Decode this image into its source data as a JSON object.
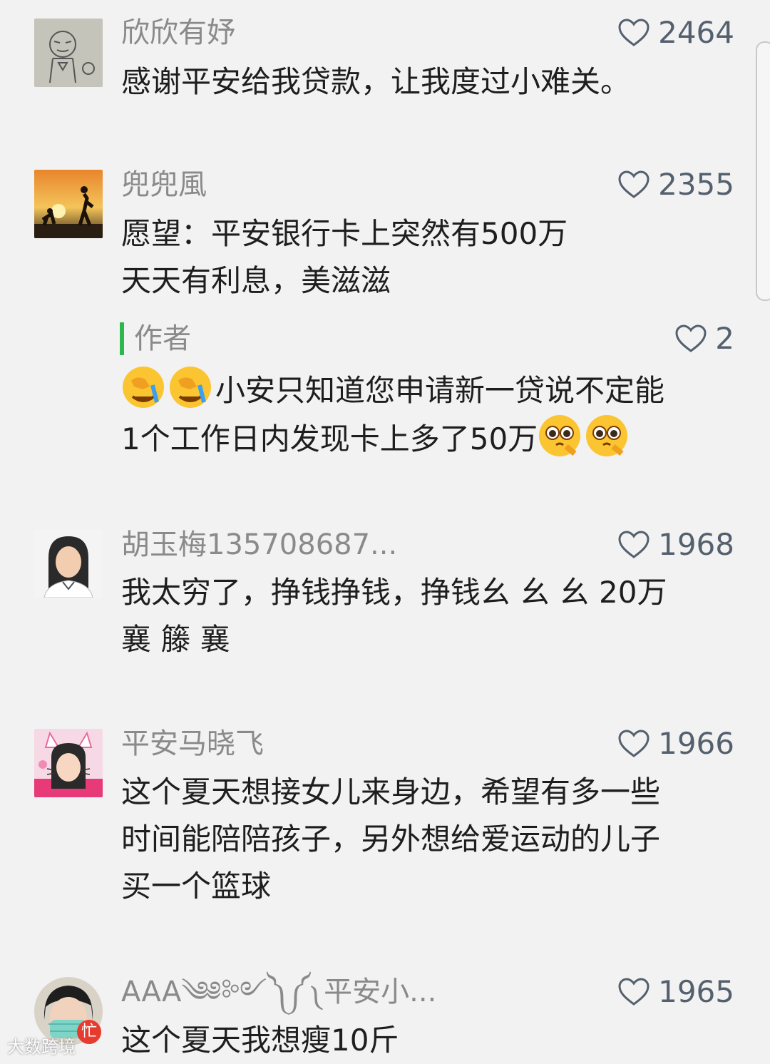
{
  "comments": [
    {
      "user": "欣欣有妤",
      "likes": "2464",
      "lines": [
        "感谢平安给我贷款，让我度过小难关。"
      ],
      "avatar_icon": "sketch-cartoon-avatar"
    },
    {
      "user": "兜兜風",
      "likes": "2355",
      "lines": [
        "愿望：平安银行卡上突然有500万",
        "天天有利息，美滋滋"
      ],
      "avatar_icon": "sunset-silhouette-avatar",
      "reply": {
        "user": "作者",
        "likes": "2",
        "line1": "小安只知道您申请新一贷说不定能",
        "line2": "1个工作日内发现卡上多了50万",
        "emoji_start": "facepalm-crying-emoji",
        "emoji_end": "pleading-eyes-emoji"
      }
    },
    {
      "user": "胡玉梅135708687...",
      "likes": "1968",
      "lines": [
        "我太穷了，挣钱挣钱，挣钱幺 幺 幺 20万",
        "襄 籐 襄"
      ],
      "avatar_icon": "portrait-photo-avatar"
    },
    {
      "user": "平安马晓飞",
      "likes": "1966",
      "lines": [
        "这个夏天想接女儿来身边，希望有多一些",
        "时间能陪陪孩子，另外想给爱运动的儿子",
        "买一个篮球"
      ],
      "avatar_icon": "cat-ears-selfie-avatar"
    },
    {
      "user": "AAA༄༅༻༽༼༾平安小...",
      "likes": "1965",
      "lines": [
        "这个夏天我想瘦10斤"
      ],
      "avatar_icon": "masked-child-avatar",
      "badge": "忙"
    }
  ],
  "watermark": "大数跨境",
  "colors": {
    "background": "#f2f2f2",
    "reply_bar": "#2db84d",
    "like": "#55606e",
    "username": "#8a8a8a"
  }
}
